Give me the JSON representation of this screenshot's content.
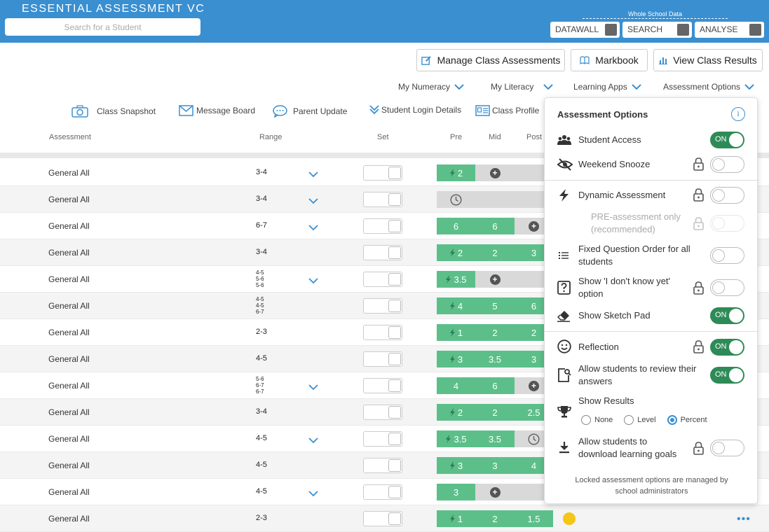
{
  "header": {
    "app_title": "ESSENTIAL ASSESSMENT VC",
    "search_placeholder": "Search for a Student",
    "whole_school_label": "Whole School Data",
    "buttons": [
      "DATAWALL",
      "SEARCH",
      "ANALYSE"
    ]
  },
  "toolbar": {
    "manage": "Manage Class Assessments",
    "markbook": "Markbook",
    "view_results": "View Class Results"
  },
  "menus": [
    "My Numeracy",
    "My Literacy",
    "Learning Apps",
    "Assessment Options"
  ],
  "tools": [
    "Class Snapshot",
    "Message Board",
    "Parent Update",
    "Student Login Details",
    "Class Profile"
  ],
  "columns": {
    "assessment": "Assessment",
    "range": "Range",
    "set": "Set",
    "pre": "Pre",
    "mid": "Mid",
    "post": "Post"
  },
  "rows": [
    {
      "name": "General All",
      "range": [
        "3-4"
      ],
      "chevron": true,
      "pre": "2",
      "pre_icon": "bolt",
      "mid": "+",
      "post": ""
    },
    {
      "name": "General All",
      "range": [
        "3-4"
      ],
      "chevron": true,
      "pre": "clock",
      "mid": "",
      "post": ""
    },
    {
      "name": "General All",
      "range": [
        "6-7"
      ],
      "chevron": true,
      "pre": "6",
      "mid": "6",
      "post": "+"
    },
    {
      "name": "General All",
      "range": [
        "3-4"
      ],
      "chevron": false,
      "pre": "2",
      "pre_icon": "bolt",
      "mid": "2",
      "post": "3"
    },
    {
      "name": "General All",
      "range": [
        "4-5",
        "5-6",
        "5-6"
      ],
      "chevron": true,
      "pre": "3.5",
      "pre_icon": "bolt",
      "mid": "+",
      "post": ""
    },
    {
      "name": "General All",
      "range": [
        "4-5",
        "4-5",
        "6-7"
      ],
      "chevron": false,
      "pre": "4",
      "pre_icon": "bolt",
      "mid": "5",
      "post": "6"
    },
    {
      "name": "General All",
      "range": [
        "2-3"
      ],
      "chevron": false,
      "pre": "1",
      "pre_icon": "bolt",
      "mid": "2",
      "post": "2"
    },
    {
      "name": "General All",
      "range": [
        "4-5"
      ],
      "chevron": false,
      "pre": "3",
      "pre_icon": "bolt",
      "mid": "3.5",
      "post": "3"
    },
    {
      "name": "General All",
      "range": [
        "5-6",
        "6-7",
        "6-7"
      ],
      "chevron": true,
      "pre": "4",
      "mid": "6",
      "post": "+"
    },
    {
      "name": "General All",
      "range": [
        "3-4"
      ],
      "chevron": false,
      "pre": "2",
      "pre_icon": "bolt",
      "mid": "2",
      "post": "2.5"
    },
    {
      "name": "General All",
      "range": [
        "4-5"
      ],
      "chevron": true,
      "pre": "3.5",
      "pre_icon": "bolt",
      "mid": "3.5",
      "post": "clock"
    },
    {
      "name": "General All",
      "range": [
        "4-5"
      ],
      "chevron": false,
      "pre": "3",
      "pre_icon": "bolt",
      "mid": "3",
      "post": "4"
    },
    {
      "name": "General All",
      "range": [
        "4-5"
      ],
      "chevron": true,
      "pre": "3",
      "mid": "+",
      "post": ""
    },
    {
      "name": "General All",
      "range": [
        "2-3"
      ],
      "chevron": false,
      "pre": "1",
      "pre_icon": "bolt",
      "mid": "2",
      "post": "1.5"
    }
  ],
  "panel": {
    "title": "Assessment Options",
    "on_label": "ON",
    "options": {
      "student_access": "Student Access",
      "weekend_snooze": "Weekend Snooze",
      "dynamic_assessment": "Dynamic Assessment",
      "pre_only_1": "PRE-assessment only",
      "pre_only_2": "(recommended)",
      "fixed_order_1": "Fixed Question Order for all",
      "fixed_order_2": "students",
      "idk_1": "Show 'I don't know yet'",
      "idk_2": "option",
      "sketch_pad": "Show Sketch Pad",
      "reflection": "Reflection",
      "review_1": "Allow students to review their",
      "review_2": "answers",
      "show_results": "Show Results",
      "download_1": "Allow students to",
      "download_2": "download learning goals"
    },
    "results_options": [
      "None",
      "Level",
      "Percent"
    ],
    "results_selected": "Percent",
    "footer_1": "Locked assessment options are managed by",
    "footer_2": "school administrators"
  },
  "colors": {
    "brand": "#3a8fd0",
    "result_green": "#5cbf8a",
    "toggle_on": "#2e8b57"
  }
}
